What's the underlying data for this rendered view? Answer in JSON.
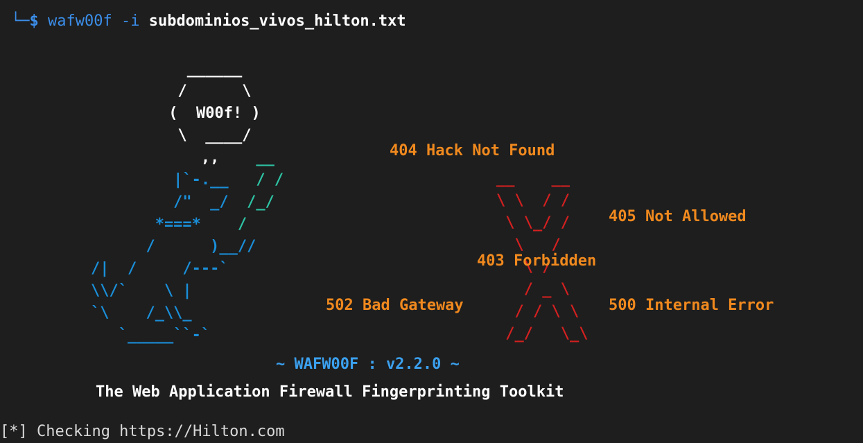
{
  "prompt": {
    "tree": "└─",
    "symbol": "$",
    "command": "wafw00f -i",
    "argument": "subdominios_vivos_hilton.txt"
  },
  "banner": {
    "bubble_text": "W00f!",
    "errors": {
      "e404": "404 Hack Not Found",
      "e405": "405 Not Allowed",
      "e403": "403 Forbidden",
      "e502": "502 Bad Gateway",
      "e500": "500 Internal Error"
    },
    "version": "~ WAFW00F : v2.2.0 ~",
    "tagline": "The Web Application Firewall Fingerprinting Toolkit"
  },
  "status_line": "[*] Checking https://Hilton.com",
  "colors": {
    "background": "#1e1e1e",
    "prompt_blue": "#3b8eea",
    "error_orange": "#f0891e",
    "x_red": "#d42020",
    "dog_blue": "#1a8fd9",
    "dog_teal": "#2ec4a5"
  }
}
